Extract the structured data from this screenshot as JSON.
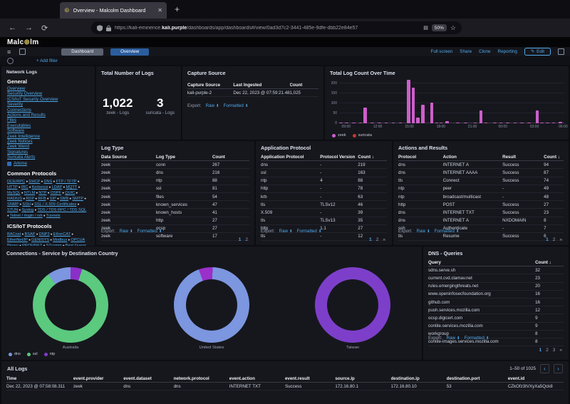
{
  "icons": {
    "close": "✕",
    "plus": "+",
    "back": "←",
    "forward": "→",
    "reload": "⟳",
    "menu": "≡",
    "star": "☆",
    "reader": "▤",
    "download": "⬇",
    "dot": "●",
    "edit": "✎",
    "chev_left": "‹",
    "chev_right": "›"
  },
  "browser": {
    "tab_title": "Overview - Malcolm Dashboard",
    "url_scheme": "https://kali-eminence.",
    "url_host": "kali.purple",
    "url_path": "/dashboards/app/dashboards#/view/0ad3d7c2-3441-485e-9dfe-dbb22e84e57",
    "zoom_level": "50%"
  },
  "header": {
    "logo_a": "Malc",
    "logo_sym": "⊛",
    "logo_b": "lm"
  },
  "nav": {
    "breadcrumbs": [
      {
        "label": "Dashboard"
      },
      {
        "label": "Overview"
      }
    ],
    "actions": [
      "Full screen",
      "Share",
      "Clone",
      "Reporting"
    ],
    "edit_label": "Edit"
  },
  "filter_bar": {
    "add_filter": "+ Add filter"
  },
  "export": {
    "label": "Export:",
    "raw": "Raw",
    "formatted": "Formatted"
  },
  "sidebar": {
    "title": "Network Logs",
    "general_heading": "General",
    "general_items": [
      "Overview",
      "Security Overview",
      "ICS/IoT Security Overview",
      "Severity",
      "Connections",
      "Actions and Results",
      "Files",
      "Executables",
      "Software",
      "Zeek Intelligence",
      "Zeek Notices",
      "Zeek Weird",
      "Signatures",
      "Suricata Alerts"
    ],
    "arkime_label": "Arkime",
    "common_heading": "Common Protocols",
    "common_items": [
      "DCE/RPC",
      "DHCP",
      "DNS",
      "FTP / TFTP",
      "HTTP",
      "IRC",
      "Kerberos",
      "LDAP",
      "MQTT",
      "MySQL",
      "NTLM",
      "NTP",
      "OSPF",
      "QUIC",
      "RADIUS",
      "RDP",
      "RFB",
      "SIP",
      "SMB",
      "SMTP",
      "SNMP",
      "SSH",
      "SSL / X.509 Certificates",
      "STUN",
      "Syslog",
      "TDS / TDS RPC / TDS SQL",
      "Telnet / rlogin / rsh",
      "Tunnels"
    ],
    "ics_heading": "ICS/IoT Protocols",
    "ics_items": [
      "BACnet",
      "BSAP",
      "DNP3",
      "EtherCAT",
      "EtherNet/IP",
      "GENISYS",
      "Modbus",
      "OPCUA Binary",
      "PROFINET",
      "S7comm",
      "Best Guess"
    ]
  },
  "panels": {
    "total_logs": {
      "title": "Total Number of Logs",
      "metrics": [
        {
          "value": "1,022",
          "label": "zeek - Logs"
        },
        {
          "value": "3",
          "label": "suricata - Logs"
        }
      ]
    },
    "capture_source": {
      "title": "Capture Source",
      "headers": [
        "Capture Source",
        "Last Ingested",
        "Count"
      ],
      "widths": [
        "35%",
        "43%",
        "22%"
      ],
      "rows": [
        [
          "kali-purple-2",
          "Dec 22, 2023 @ 07:59:21.484",
          "1,025"
        ]
      ]
    },
    "log_count_chart": {
      "title": "Total Log Count Over Time",
      "type": "bar",
      "ymax": 230,
      "yticks": [
        0,
        50,
        100,
        150,
        200
      ],
      "xticks": [
        "09:00",
        "12:00",
        "15:00",
        "18:00",
        "21:00",
        "00:00",
        "03:00",
        "06:00"
      ],
      "xtick_pos": [
        3.1,
        17.1,
        31.2,
        45.2,
        59.2,
        72.7,
        86.7,
        99.5
      ],
      "bar_color": "#CE5ECB",
      "legend": [
        {
          "label": "zeek",
          "color": "#CE5ECB"
        },
        {
          "label": "suricata",
          "color": "#C03A2B"
        }
      ],
      "bars": [
        [
          0,
          3
        ],
        [
          2.6,
          2
        ],
        [
          5.7,
          2
        ],
        [
          8.8,
          3
        ],
        [
          10.9,
          80
        ],
        [
          14,
          2
        ],
        [
          17.1,
          3
        ],
        [
          20.2,
          2
        ],
        [
          23.4,
          3
        ],
        [
          26.5,
          2
        ],
        [
          30.1,
          220
        ],
        [
          32.2,
          178
        ],
        [
          34.3,
          30
        ],
        [
          36.4,
          93
        ],
        [
          40.5,
          105
        ],
        [
          42.6,
          5
        ],
        [
          44.6,
          3
        ],
        [
          47.2,
          12
        ],
        [
          51.9,
          4
        ],
        [
          55.5,
          5
        ],
        [
          59.7,
          5
        ],
        [
          62.3,
          65
        ],
        [
          64.4,
          4
        ],
        [
          68.5,
          3
        ],
        [
          71.1,
          3
        ],
        [
          74.2,
          4
        ],
        [
          77.4,
          3
        ],
        [
          80.5,
          4
        ],
        [
          83.6,
          3
        ],
        [
          87.2,
          63
        ],
        [
          89.3,
          4
        ],
        [
          91.9,
          3
        ],
        [
          94.5,
          3
        ],
        [
          97.6,
          8
        ]
      ]
    },
    "log_type": {
      "title": "Log Type",
      "headers": [
        "Data Source",
        "Log Type",
        "Count"
      ],
      "widths": [
        "37%",
        "38%",
        "25%"
      ],
      "rows": [
        [
          "zeek",
          "conn",
          "267"
        ],
        [
          "zeek",
          "dns",
          "216"
        ],
        [
          "zeek",
          "ntp",
          "88"
        ],
        [
          "zeek",
          "ssl",
          "81"
        ],
        [
          "zeek",
          "files",
          "54"
        ],
        [
          "zeek",
          "known_services",
          "47"
        ],
        [
          "zeek",
          "known_hosts",
          "41"
        ],
        [
          "zeek",
          "http",
          "27"
        ],
        [
          "zeek",
          "ocsp",
          "27"
        ],
        [
          "zeek",
          "software",
          "17"
        ]
      ],
      "pages": [
        "1",
        "2"
      ]
    },
    "app_protocol": {
      "title": "Application Protocol",
      "headers": [
        "Application Protocol",
        "Protocol Version",
        "Count ↓"
      ],
      "widths": [
        "47%",
        "30%",
        "23%"
      ],
      "rows": [
        [
          "dns",
          "-",
          "219"
        ],
        [
          "ssl",
          "-",
          "163"
        ],
        [
          "ntp",
          "4",
          "88"
        ],
        [
          "http",
          "-",
          "78"
        ],
        [
          "krb",
          "-",
          "63"
        ],
        [
          "tls",
          "TLSv12",
          "46"
        ],
        [
          "X.509",
          "-",
          "39"
        ],
        [
          "tls",
          "TLSv13",
          "35"
        ],
        [
          "http",
          "1.1",
          "27"
        ],
        [
          "tls",
          "-",
          "12"
        ]
      ],
      "pages": [
        "1",
        "2",
        "»"
      ]
    },
    "actions_results": {
      "title": "Actions and Results",
      "headers": [
        "Protocol",
        "Action",
        "Result",
        "Count ↓"
      ],
      "widths": [
        "27%",
        "36%",
        "25%",
        "12%"
      ],
      "rows": [
        [
          "dns",
          "INTERNET A",
          "Success",
          "94"
        ],
        [
          "dns",
          "INTERNET AAAA",
          "Success",
          "87"
        ],
        [
          "tls",
          "Connect",
          "Success",
          "74"
        ],
        [
          "ntp",
          "peer",
          "-",
          "49"
        ],
        [
          "ntp",
          "broadcast/multicast",
          "-",
          "48"
        ],
        [
          "http",
          "POST",
          "Success",
          "27"
        ],
        [
          "dns",
          "INTERNET TXT",
          "Success",
          "23"
        ],
        [
          "dns",
          "INTERNET A",
          "NXDOMAIN",
          "8"
        ],
        [
          "ssh",
          "Authenticate",
          "-",
          "7"
        ],
        [
          "tls",
          "Resume",
          "Success",
          "6"
        ]
      ],
      "pages": [
        "1",
        "2",
        "»"
      ]
    },
    "connections": {
      "title": "Connections - Service by Destination Country",
      "legend": [
        {
          "label": "dns",
          "color": "#7C96DF"
        },
        {
          "label": "ssl",
          "color": "#5BC97E"
        },
        {
          "label": "ntp",
          "color": "#7D3FC9"
        }
      ],
      "donuts": [
        {
          "label": "Australia",
          "start": 0,
          "slices": [
            [
              "#8B2FC9",
              5
            ],
            [
              "#5BC97E",
              85
            ],
            [
              "#7C96DF",
              10
            ]
          ]
        },
        {
          "label": "United States",
          "start": -20,
          "slices": [
            [
              "#9A2FC9",
              6
            ],
            [
              "#7C96DF",
              94
            ]
          ]
        },
        {
          "label": "Taiwan",
          "start": 0,
          "slices": [
            [
              "#7D3FC9",
              100
            ]
          ]
        }
      ]
    },
    "dns_queries": {
      "title": "DNS - Queries",
      "headers": [
        "Query",
        "Count ↓"
      ],
      "widths": [
        "79%",
        "21%"
      ],
      "rows": [
        [
          "sdns.serve.sh",
          "32"
        ],
        [
          "current.cvd.clamav.net",
          "23"
        ],
        [
          "rules.emergingthreats.net",
          "20"
        ],
        [
          "www.openinfosecfoundation.org",
          "16"
        ],
        [
          "github.com",
          "16"
        ],
        [
          "push.services.mozilla.com",
          "12"
        ],
        [
          "ocsp.digicert.com",
          "9"
        ],
        [
          "contile.services.mozilla.com",
          "9"
        ],
        [
          "workgroup",
          "8"
        ],
        [
          "contile-images.services.mozilla.com",
          "8"
        ]
      ],
      "pages": [
        "1",
        "2",
        "3",
        "»"
      ]
    },
    "all_logs": {
      "title": "All Logs",
      "range": "1–50 of 1025",
      "headers": [
        "Time",
        "event.provider",
        "event.dataset",
        "network.protocol",
        "event.action",
        "event.result",
        "source.ip",
        "destination.ip",
        "destination.port",
        "event.id"
      ],
      "widths": [
        "12%",
        "9%",
        "9%",
        "10%",
        "10%",
        "9%",
        "10%",
        "10%",
        "11%",
        "10%"
      ],
      "rows": [
        [
          "Dec 22, 2023 @ 07:58:08.311",
          "zeek",
          "dns",
          "dns",
          "INTERNET TXT",
          "Success",
          "172.16.80.1",
          "172.16.80.10",
          "53",
          "CZkOfz3tVXyXa5Qck8"
        ]
      ]
    }
  }
}
